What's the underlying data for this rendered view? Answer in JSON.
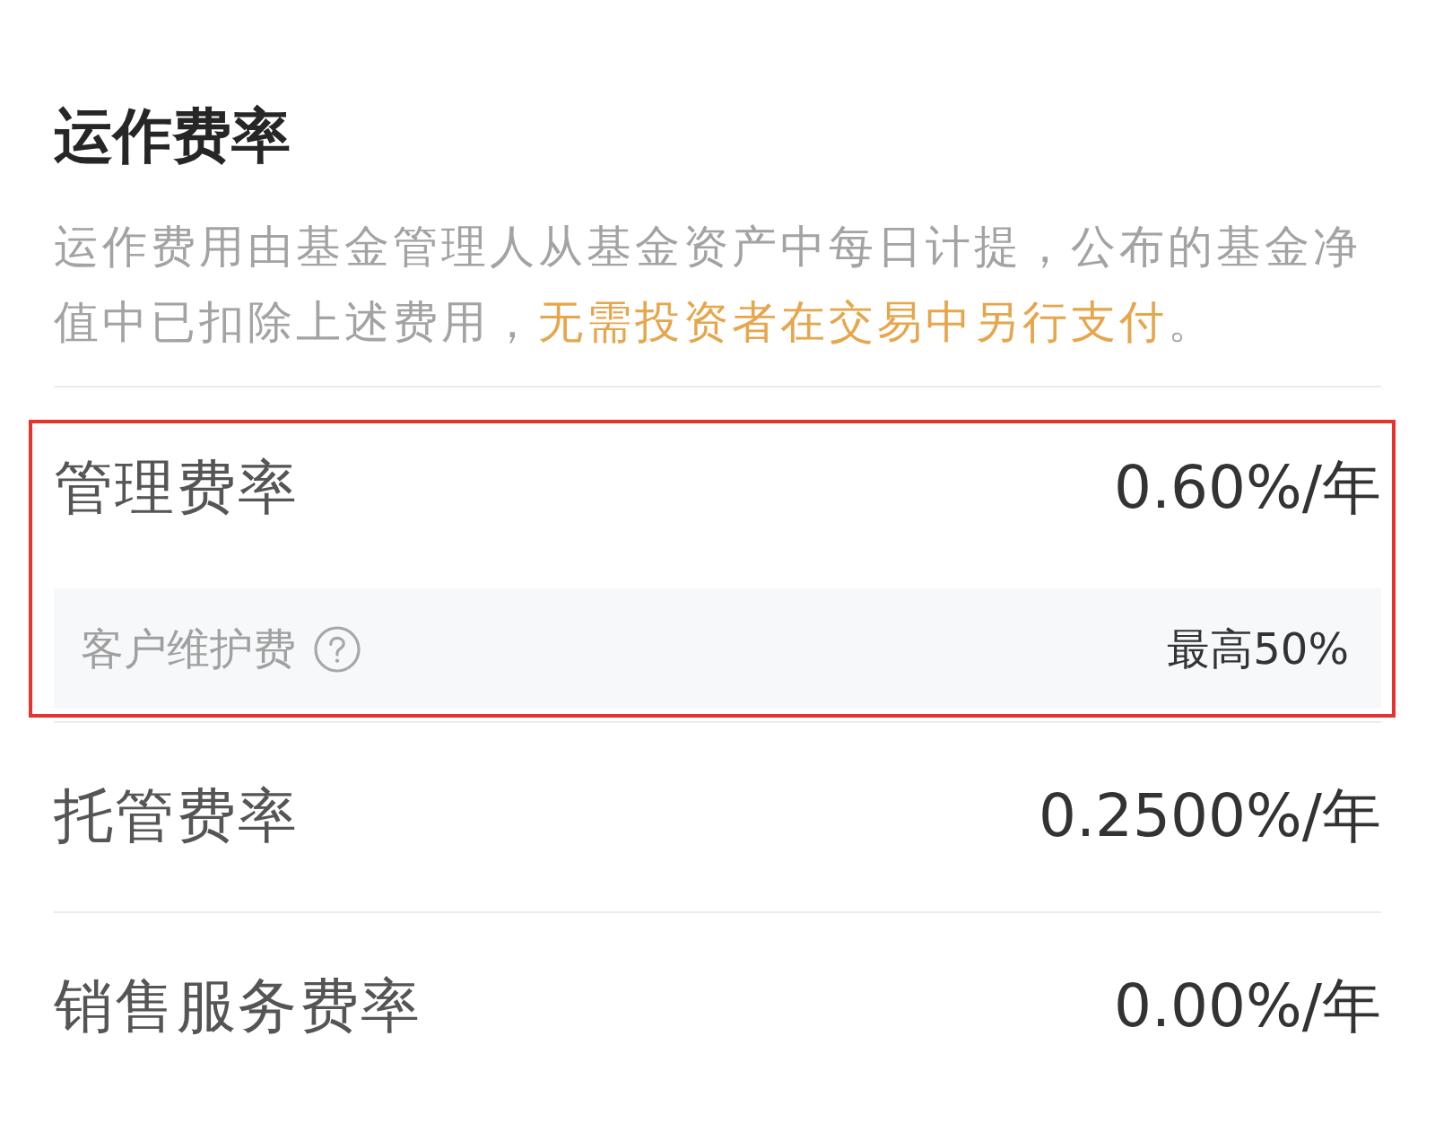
{
  "section": {
    "title": "运作费率",
    "description": [
      {
        "kind": "plain",
        "text": "运作费用由基金管理人从基金资产中每日计提，公布的基金净值中已扣除上述费用，"
      },
      {
        "kind": "highlight",
        "text": "无需投资者在交易中另行支付"
      },
      {
        "kind": "plain",
        "text": "。"
      }
    ]
  },
  "rows": [
    {
      "label": "管理费率",
      "value": "0.60%/年",
      "highlighted": true,
      "sub_rows": [
        {
          "label": "客户维护费",
          "value": "最高50%"
        }
      ]
    },
    {
      "label": "托管费率",
      "value": "0.2500%/年",
      "highlighted": false
    },
    {
      "label": "销售服务费率",
      "value": "0.00%/年",
      "highlighted": false
    }
  ]
}
